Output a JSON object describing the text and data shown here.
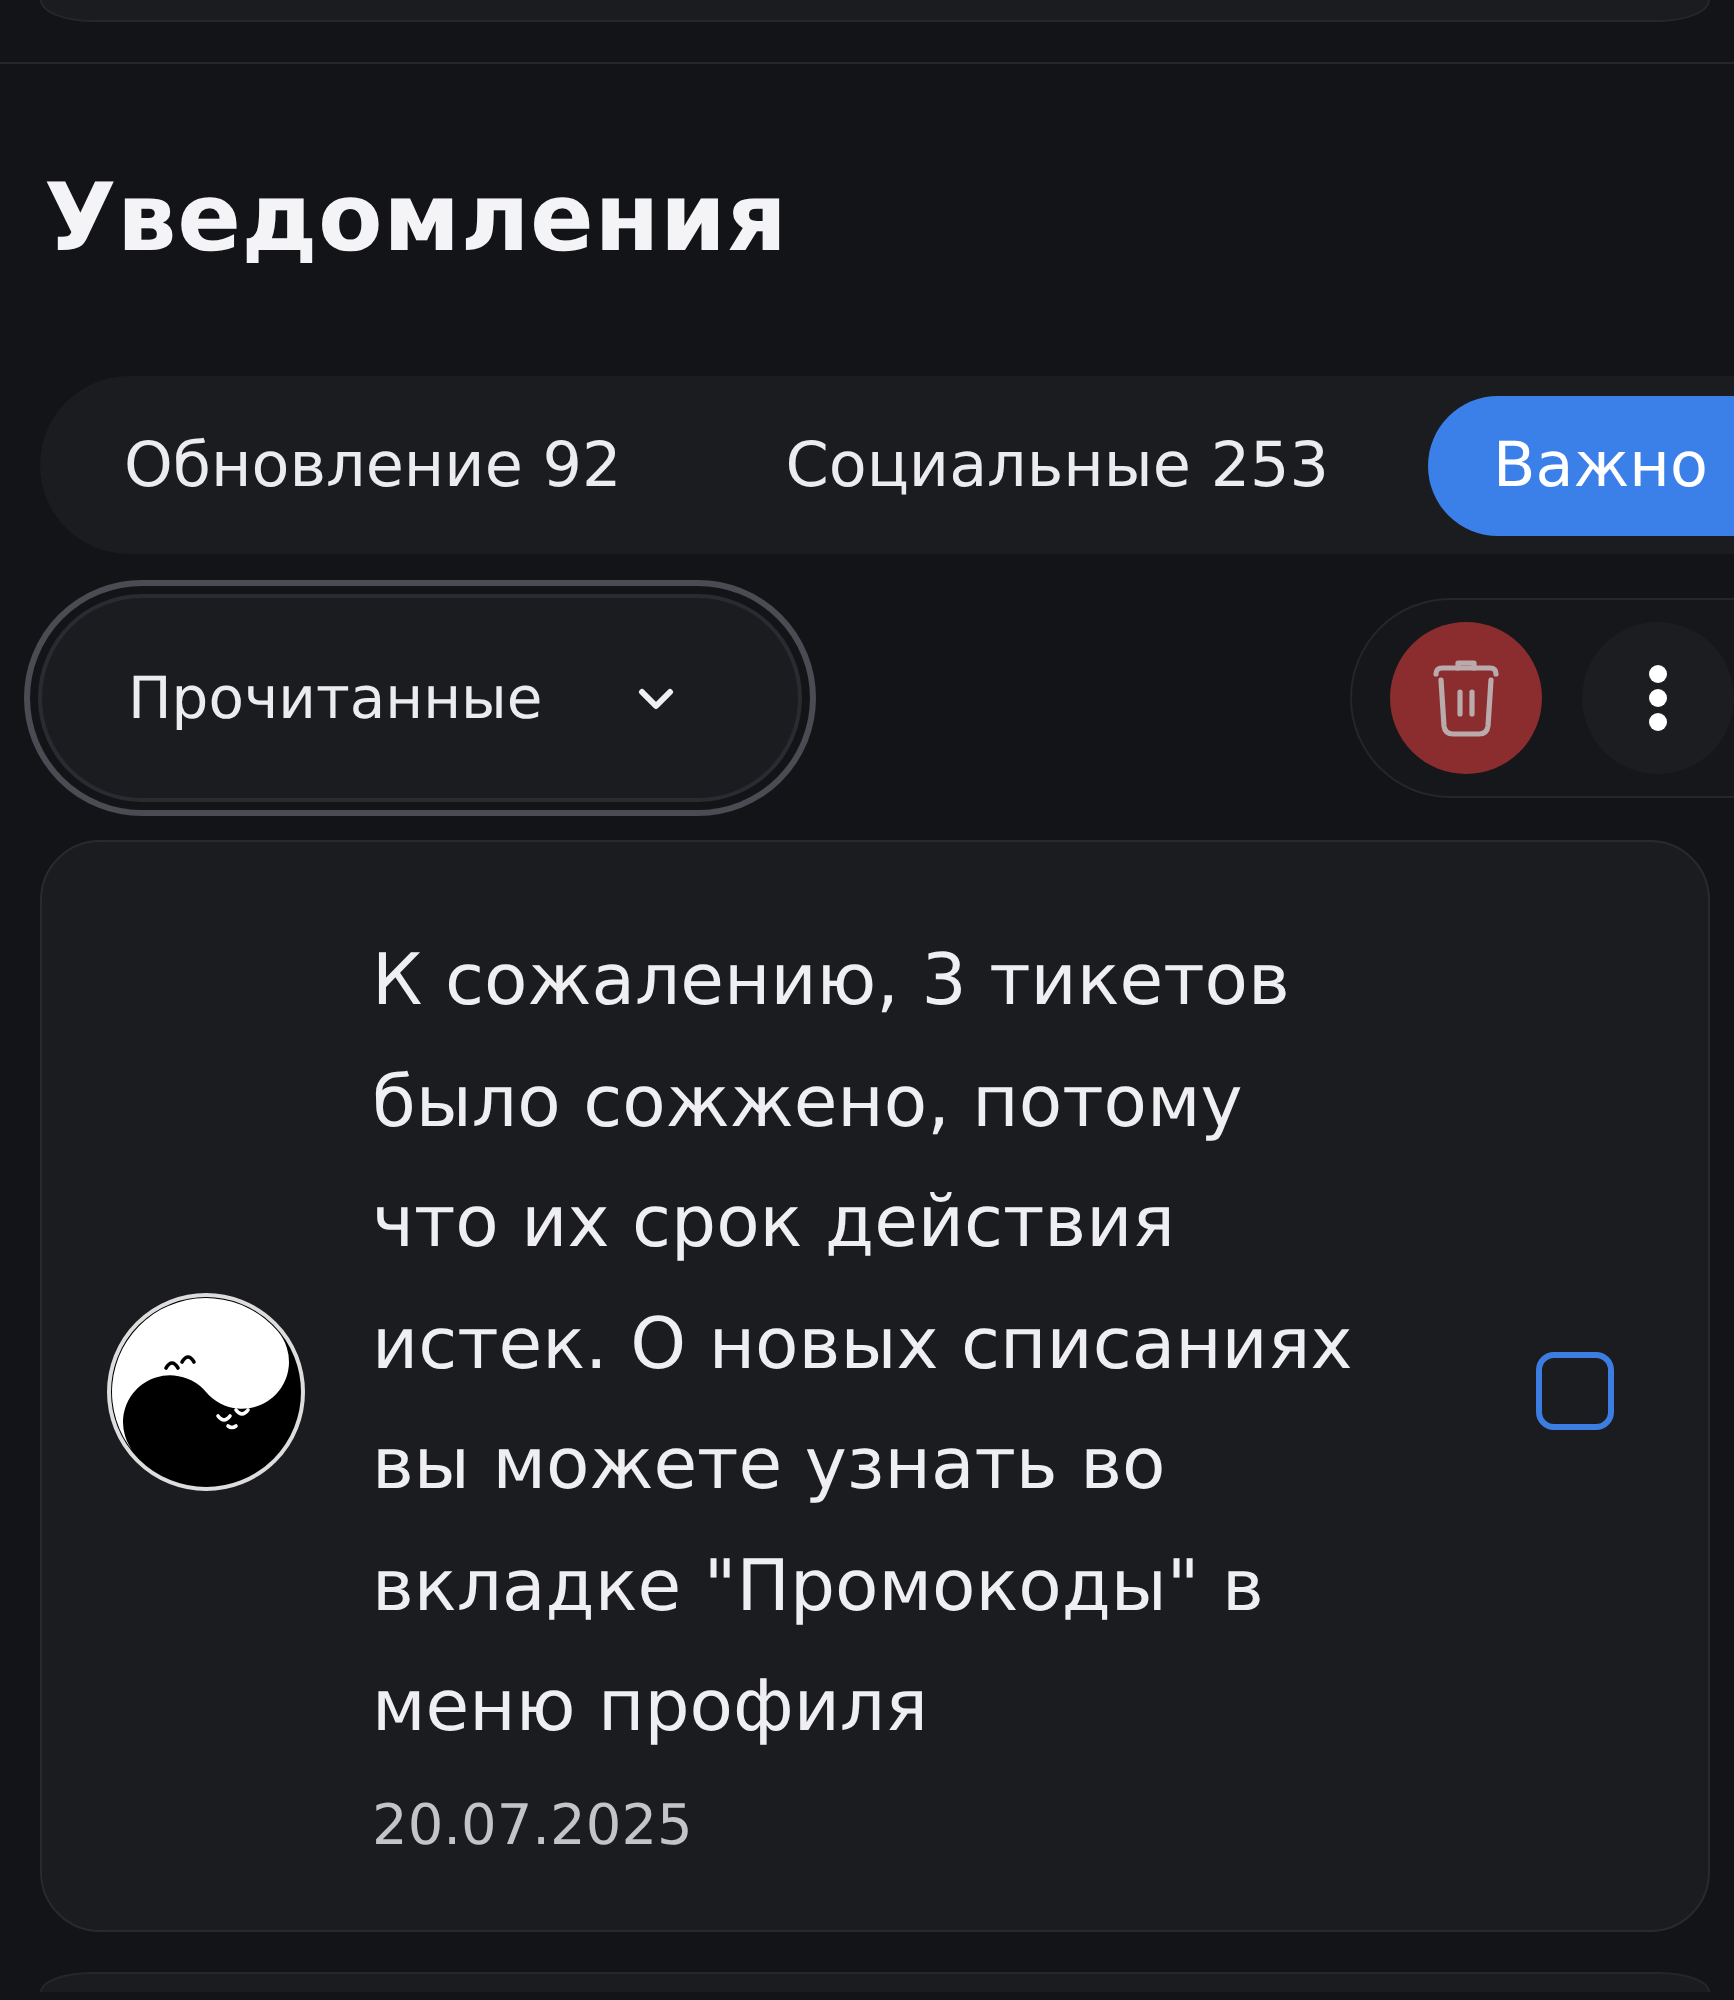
{
  "title": "Уведомления",
  "tabs": [
    {
      "label": "Обновление 92",
      "selected": false
    },
    {
      "label": "Социальные 253",
      "selected": false
    },
    {
      "label": "Важно",
      "selected": true
    }
  ],
  "filter": {
    "value": "Прочитанные"
  },
  "notifications": [
    {
      "text": "К сожалению, 3 тикетов было сожжено, потому что их срок действия истек. О новых списаниях вы можете узнать во вкладке \"Промокоды\" в меню профиля",
      "date": "20.07.2025",
      "checked": false
    }
  ]
}
